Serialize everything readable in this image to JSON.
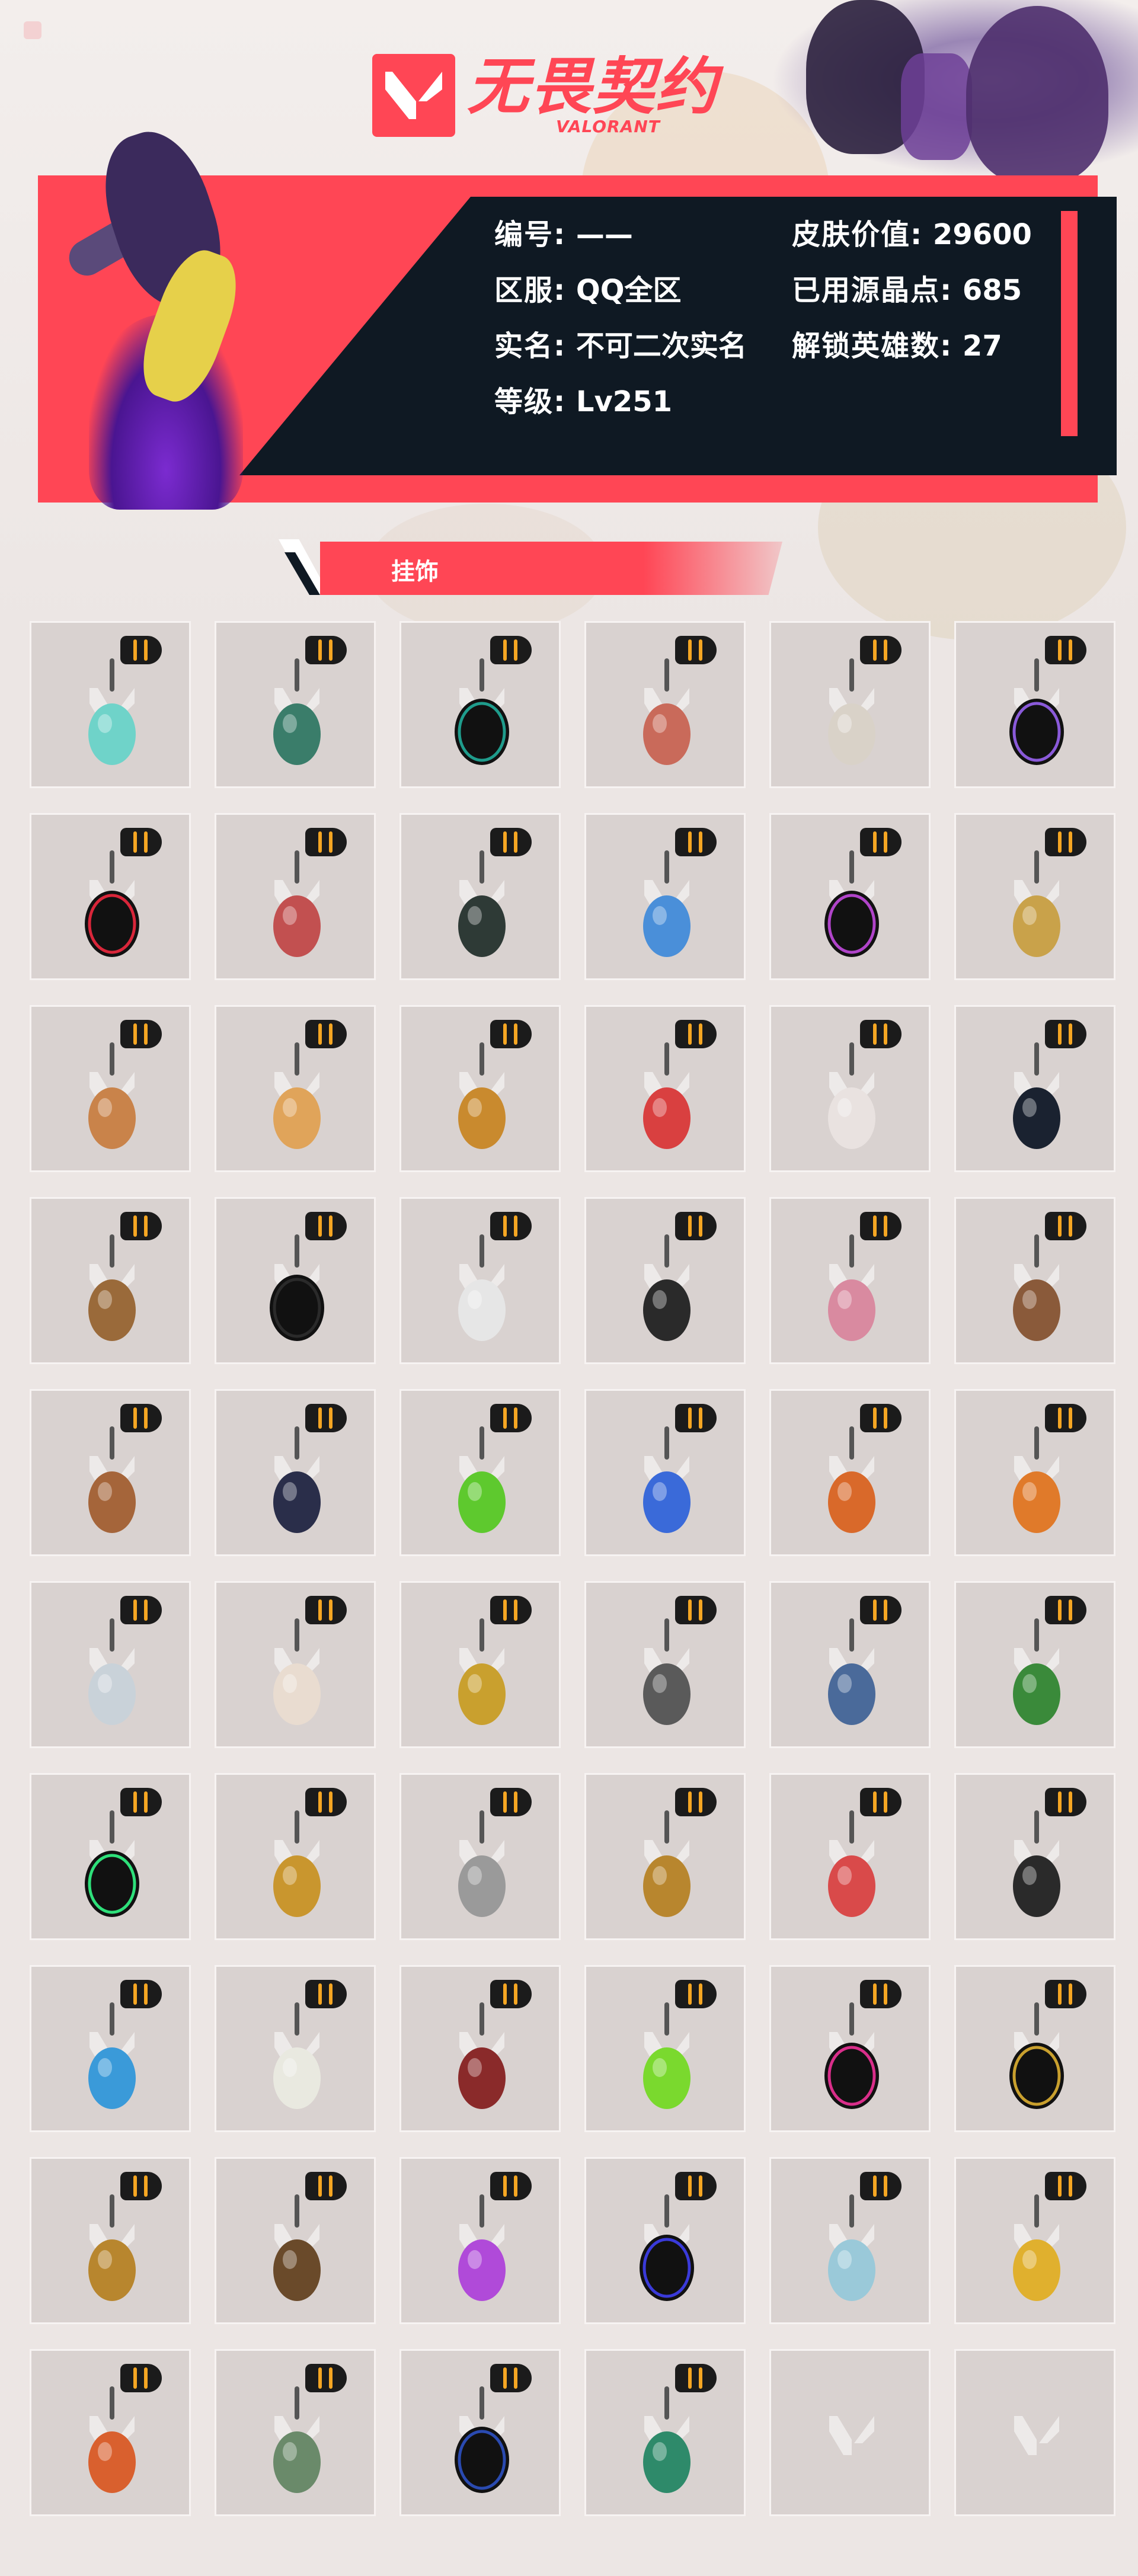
{
  "logo": {
    "title_cn": "无畏契约",
    "title_en": "VALORANT"
  },
  "account": [
    {
      "label": "编号:",
      "value": "——"
    },
    {
      "label": "区服:",
      "value": "QQ全区"
    },
    {
      "label": "实名:",
      "value": "不可二次实名"
    },
    {
      "label": "等级:",
      "value": "Lv251"
    },
    {
      "label": "皮肤价值:",
      "value": "29600"
    },
    {
      "label": "已用源晶点:",
      "value": "685"
    },
    {
      "label": "解锁英雄数:",
      "value": "27"
    }
  ],
  "section": {
    "label": "挂饰"
  },
  "colors": {
    "accent": "#ff4655",
    "dark": "#0f1923",
    "tile_bg": "#d9d2d0",
    "page_bg": "#ece6e4"
  },
  "buddies": [
    {
      "icon": "mushroom-charm-icon",
      "color": "#6fd3c9"
    },
    {
      "icon": "ufo-charm-icon",
      "color": "#3a7d6a"
    },
    {
      "icon": "v25-vi-medal-icon",
      "color": "#1f9c8c"
    },
    {
      "icon": "green-figure-charm-icon",
      "color": "#c96a5a"
    },
    {
      "icon": "rocket-charm-icon",
      "color": "#d9d2c8"
    },
    {
      "icon": "v25-iv-medal-icon",
      "color": "#8a5ad9"
    },
    {
      "icon": "v25-iii-medal-icon",
      "color": "#d9263a"
    },
    {
      "icon": "cake-slice-charm-icon",
      "color": "#c25050"
    },
    {
      "icon": "sneaker-charm-icon",
      "color": "#2e3a36"
    },
    {
      "icon": "blue-knife-charm-icon",
      "color": "#4a8fd9"
    },
    {
      "icon": "v25-ii-medal-icon",
      "color": "#b044c9"
    },
    {
      "icon": "gold-character-charm-icon",
      "color": "#c9a24a"
    },
    {
      "icon": "astronaut-charm-icon",
      "color": "#c9834a"
    },
    {
      "icon": "planet-charm-icon",
      "color": "#e0a45a"
    },
    {
      "icon": "gold-sun-charm-icon",
      "color": "#c98a2e"
    },
    {
      "icon": "red-creature-charm-icon",
      "color": "#d94040"
    },
    {
      "icon": "cow-charm-icon",
      "color": "#e9e2e0"
    },
    {
      "icon": "black-tag-charm-icon",
      "color": "#1a2230"
    },
    {
      "icon": "ramen-bowl-charm-icon",
      "color": "#9a6a3a"
    },
    {
      "icon": "v25-i-medal-icon",
      "color": "#2a2a2a"
    },
    {
      "icon": "mech-creature-charm-icon",
      "color": "#e6e6e6"
    },
    {
      "icon": "valorant-tag-charm-icon",
      "color": "#2a2a2a"
    },
    {
      "icon": "cupcake-charm-icon",
      "color": "#d98aa0"
    },
    {
      "icon": "teddy-bear-charm-icon",
      "color": "#8a5a3a"
    },
    {
      "icon": "crate-charm-icon",
      "color": "#a5653a"
    },
    {
      "icon": "dark-figure-charm-icon",
      "color": "#2a2e4a"
    },
    {
      "icon": "green-pager-charm-icon",
      "color": "#5ec92e"
    },
    {
      "icon": "blue-robot-charm-icon",
      "color": "#3a6ad9"
    },
    {
      "icon": "radio-charm-icon",
      "color": "#d9692a"
    },
    {
      "icon": "orange-ball-charm-icon",
      "color": "#e07a2a"
    },
    {
      "icon": "key-charm-icon",
      "color": "#c9d2d9"
    },
    {
      "icon": "dumpling-charm-icon",
      "color": "#e9dcd0"
    },
    {
      "icon": "gold-ball-charm-icon",
      "color": "#c9a02e"
    },
    {
      "icon": "raccoon-charm-icon",
      "color": "#5a5a5a"
    },
    {
      "icon": "flag-shield-charm-icon",
      "color": "#4a6a9a"
    },
    {
      "icon": "flytrap-charm-icon",
      "color": "#3a8a3a"
    },
    {
      "icon": "2020-medal-icon",
      "color": "#2ee07a"
    },
    {
      "icon": "gold-tiger-charm-icon",
      "color": "#c9962e"
    },
    {
      "icon": "basket-charm-icon",
      "color": "#9a9a9a"
    },
    {
      "icon": "shield-crest-charm-icon",
      "color": "#b8862e"
    },
    {
      "icon": "wreath-v5-charm-icon",
      "color": "#d94a4a"
    },
    {
      "icon": "dark-dragon-charm-icon",
      "color": "#2a2a2a"
    },
    {
      "icon": "water-bottle-charm-icon",
      "color": "#3a9ad9"
    },
    {
      "icon": "mahjong-tile-charm-icon",
      "color": "#e9e9e0"
    },
    {
      "icon": "rope-knot-charm-icon",
      "color": "#8a2a2a"
    },
    {
      "icon": "green-snake-charm-icon",
      "color": "#7ad92e"
    },
    {
      "icon": "ep9-pink-medal-icon",
      "color": "#d92e8a"
    },
    {
      "icon": "v25-v-medal-icon",
      "color": "#c9a02e"
    },
    {
      "icon": "gold-robot-charm-icon",
      "color": "#b8862e"
    },
    {
      "icon": "turret-charm-icon",
      "color": "#6a4a2a"
    },
    {
      "icon": "lava-lamp-charm-icon",
      "color": "#b04ad9"
    },
    {
      "icon": "ep9-blue-medal-icon",
      "color": "#3a3ad9"
    },
    {
      "icon": "anime-girl-charm-icon",
      "color": "#9ac9d9"
    },
    {
      "icon": "cheese-charm-icon",
      "color": "#e0b02e"
    },
    {
      "icon": "fish-skewer-charm-icon",
      "color": "#d9602e"
    },
    {
      "icon": "espresso-robot-charm-icon",
      "color": "#6a8a6a"
    },
    {
      "icon": "ep9-gold-medal-icon",
      "color": "#2a4ab0"
    },
    {
      "icon": "green-gem-charm-icon",
      "color": "#2e8a6a"
    },
    {
      "icon": "empty-slot-icon",
      "color": ""
    },
    {
      "icon": "empty-slot-icon",
      "color": ""
    }
  ]
}
